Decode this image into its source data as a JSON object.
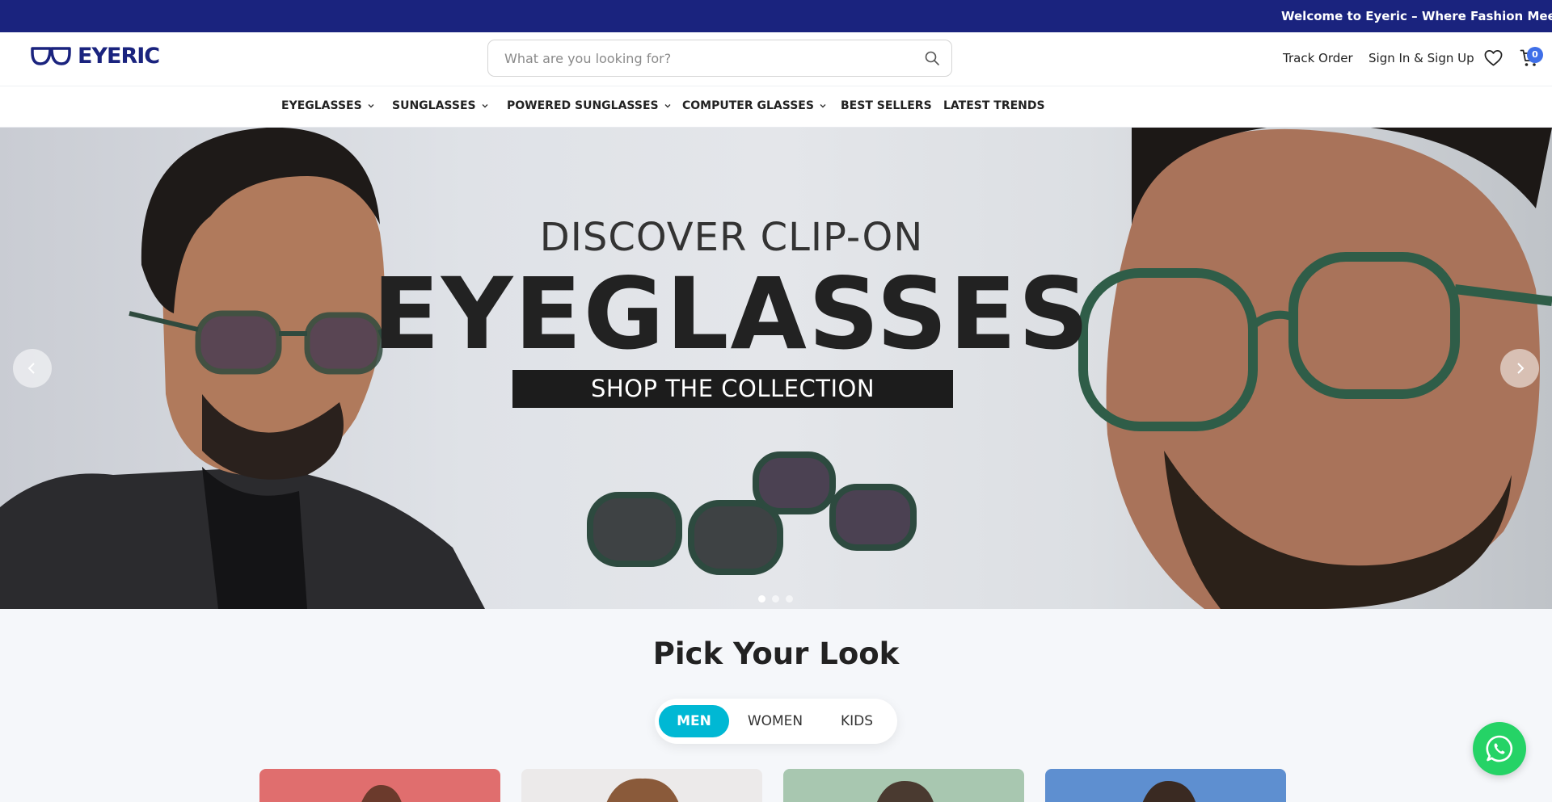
{
  "announcement": {
    "text": "Welcome to Eyeric – Where Fashion Meets Visio"
  },
  "header": {
    "brand": "EYERIC",
    "search_placeholder": "What are you looking for?",
    "track_order": "Track Order",
    "sign_in": "Sign In & Sign Up",
    "cart_count": "0",
    "icons": [
      "search-icon",
      "heart-icon",
      "cart-icon"
    ]
  },
  "nav": {
    "items": [
      {
        "label": "EYEGLASSES",
        "has_dropdown": true
      },
      {
        "label": "SUNGLASSES",
        "has_dropdown": true
      },
      {
        "label": "POWERED SUNGLASSES",
        "has_dropdown": true
      },
      {
        "label": "COMPUTER GLASSES",
        "has_dropdown": true
      },
      {
        "label": "BEST SELLERS",
        "has_dropdown": false
      },
      {
        "label": "LATEST TRENDS",
        "has_dropdown": false
      }
    ]
  },
  "hero": {
    "subtitle": "DISCOVER CLIP-ON",
    "title": "EYEGLASSES",
    "cta": "SHOP THE COLLECTION",
    "slide_count": 3,
    "active_slide": 1
  },
  "look": {
    "title": "Pick Your Look",
    "tabs": [
      {
        "label": "MEN",
        "active": true
      },
      {
        "label": "WOMEN",
        "active": false
      },
      {
        "label": "KIDS",
        "active": false
      }
    ]
  },
  "colors": {
    "brand_navy": "#1a237e",
    "accent_cyan": "#00b8d4",
    "whatsapp_green": "#25d366",
    "cart_badge": "#3f6fe8"
  }
}
